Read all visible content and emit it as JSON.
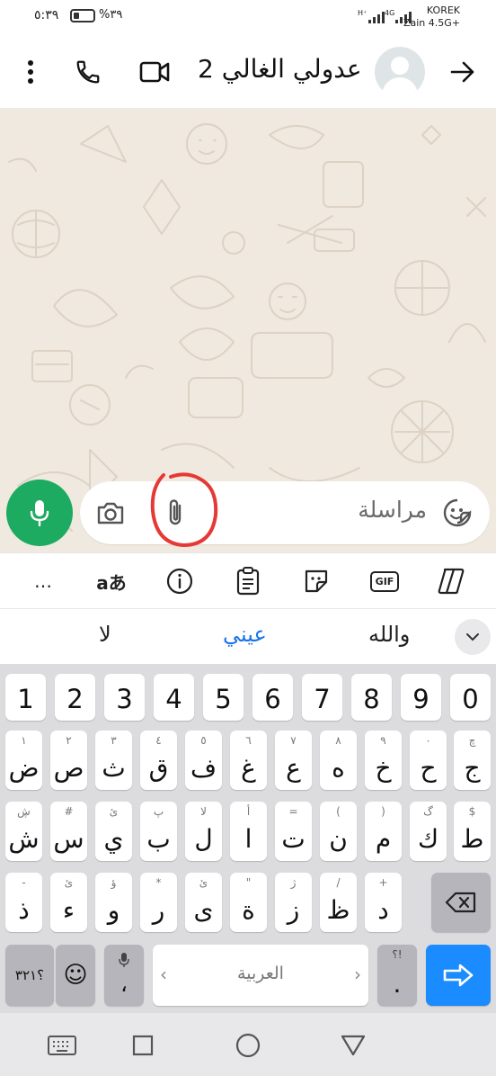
{
  "status_bar": {
    "time": "٥:٣٩",
    "battery": "%٣٩",
    "signal_1": "H⁺",
    "signal_2": "4G",
    "carrier_1": "KOREK",
    "carrier_2": "Zain 4.5G+"
  },
  "header": {
    "contact_name": "عدولي الغالي 2",
    "icons": [
      "menu-icon",
      "phone-icon",
      "video-icon",
      "avatar",
      "back-arrow-icon"
    ]
  },
  "composer": {
    "placeholder": "مراسلة",
    "icons": [
      "mic-icon",
      "camera-icon",
      "attach-icon",
      "sticker-icon"
    ],
    "accent": "#1daa61",
    "highlight_color": "#e53935"
  },
  "keyboard_toolbar": {
    "items": [
      "…",
      "aあ",
      "info-icon",
      "clipboard-icon",
      "sticker-icon",
      "GIF",
      "copilot-icon"
    ]
  },
  "suggestions": {
    "left": "لا",
    "middle": "عيني",
    "right": "والله"
  },
  "keyboard": {
    "numbers": [
      "1",
      "2",
      "3",
      "4",
      "5",
      "6",
      "7",
      "8",
      "9",
      "0"
    ],
    "row1": [
      {
        "main": "ض",
        "sub": "١"
      },
      {
        "main": "ص",
        "sub": "٢"
      },
      {
        "main": "ث",
        "sub": "٣"
      },
      {
        "main": "ق",
        "sub": "٤"
      },
      {
        "main": "ف",
        "sub": "٥"
      },
      {
        "main": "غ",
        "sub": "٦"
      },
      {
        "main": "ع",
        "sub": "٧"
      },
      {
        "main": "ه",
        "sub": "٨"
      },
      {
        "main": "خ",
        "sub": "٩"
      },
      {
        "main": "ح",
        "sub": "٠"
      },
      {
        "main": "ج",
        "sub": "چ"
      }
    ],
    "row2": [
      {
        "main": "ش",
        "sub": "ڜ"
      },
      {
        "main": "س",
        "sub": "#"
      },
      {
        "main": "ي",
        "sub": "ئ"
      },
      {
        "main": "ب",
        "sub": "پ"
      },
      {
        "main": "ل",
        "sub": "لا"
      },
      {
        "main": "ا",
        "sub": "أ"
      },
      {
        "main": "ت",
        "sub": "="
      },
      {
        "main": "ن",
        "sub": "("
      },
      {
        "main": "م",
        "sub": ")"
      },
      {
        "main": "ك",
        "sub": "گ"
      },
      {
        "main": "ط",
        "sub": "$"
      }
    ],
    "row3": [
      {
        "main": "ذ",
        "sub": "-"
      },
      {
        "main": "ء",
        "sub": "ئ"
      },
      {
        "main": "و",
        "sub": "ؤ"
      },
      {
        "main": "ر",
        "sub": "*"
      },
      {
        "main": "ى",
        "sub": "ئ"
      },
      {
        "main": "ة",
        "sub": "\""
      },
      {
        "main": "ز",
        "sub": "ژ"
      },
      {
        "main": "ظ",
        "sub": "/"
      },
      {
        "main": "د",
        "sub": "+"
      }
    ],
    "bottom": {
      "symbols": "؟٣٢١",
      "emoji": "☺",
      "comma": "،",
      "space": "العربية",
      "period": ".",
      "period_sub": "؟!",
      "space_left": "‹",
      "space_right": "›"
    }
  },
  "navbar": {
    "items": [
      "keyboard-icon",
      "square-icon",
      "circle-icon",
      "triangle-icon"
    ]
  }
}
